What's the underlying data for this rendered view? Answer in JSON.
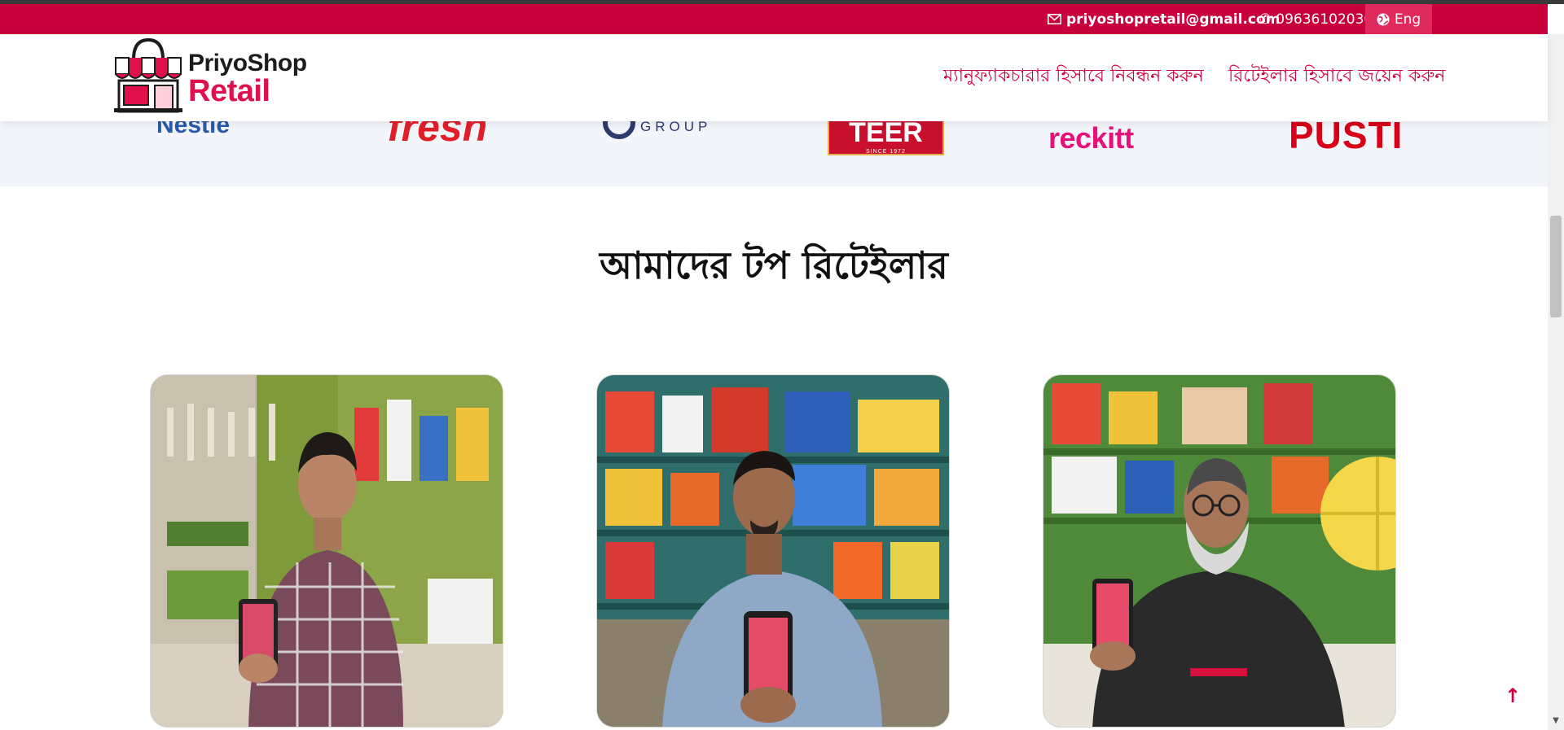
{
  "topbar": {
    "email": "priyoshopretail@gmail.com",
    "phone": "09636102030",
    "language": "Eng"
  },
  "header": {
    "logo_line1": "PriyoShop",
    "logo_line2": "Retail",
    "nav": {
      "manufacturer": "ম্যানুফ্যাকচারার হিসাবে নিবন্ধন করুন",
      "retailer": "রিটেইলার হিসাবে জয়েন করুন"
    }
  },
  "brands": {
    "nestle": "Nestle",
    "fresh": "fresh",
    "group": "GROUP",
    "teer": "TEER",
    "teer_since": "SINCE 1972",
    "reckitt": "reckitt",
    "pusti": "PUSTI"
  },
  "section": {
    "title": "আমাদের টপ রিটেইলার"
  },
  "colors": {
    "brand_red": "#c8003c",
    "accent_pink": "#e0104c"
  },
  "icons": {
    "email": "envelope-icon",
    "phone": "phone-icon",
    "language": "globe-icon",
    "back_to_top": "arrow-up-icon"
  }
}
